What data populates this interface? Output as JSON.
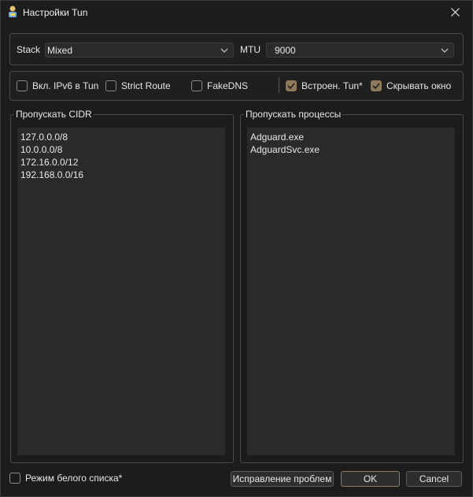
{
  "window": {
    "title": "Настройки Tun",
    "close_glyph": "close-icon"
  },
  "stack": {
    "label": "Stack",
    "value": "Mixed"
  },
  "mtu": {
    "label": "MTU",
    "value": "9000"
  },
  "options": {
    "ipv6": {
      "label": "Вкл. IPv6 в Tun",
      "checked": false
    },
    "strict_route": {
      "label": "Strict Route",
      "checked": false
    },
    "fakedns": {
      "label": "FakeDNS",
      "checked": false
    },
    "builtin_tun": {
      "label": "Встроен. Tun*",
      "checked": true
    },
    "hide_window": {
      "label": "Скрывать окно",
      "checked": true
    }
  },
  "cidr": {
    "title": "Пропускать CIDR",
    "lines": [
      "127.0.0.0/8",
      "10.0.0.0/8",
      "172.16.0.0/12",
      "192.168.0.0/16"
    ]
  },
  "processes": {
    "title": "Пропускать процессы",
    "lines": [
      "Adguard.exe",
      "AdguardSvc.exe"
    ]
  },
  "whitelist": {
    "label": "Режим белого списка*",
    "checked": false
  },
  "buttons": {
    "fix": "Исправление проблем",
    "ok": "OK",
    "cancel": "Cancel"
  },
  "colors": {
    "accent": "#8e7a5a",
    "background": "#1c1c1c",
    "field": "#2a2a2a"
  }
}
